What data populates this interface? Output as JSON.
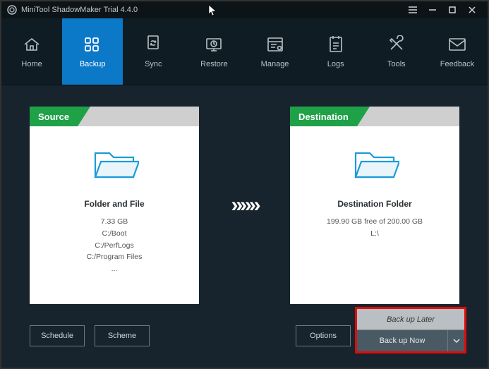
{
  "app": {
    "title": "MiniTool ShadowMaker Trial 4.4.0"
  },
  "toolbar": {
    "items": [
      {
        "label": "Home"
      },
      {
        "label": "Backup"
      },
      {
        "label": "Sync"
      },
      {
        "label": "Restore"
      },
      {
        "label": "Manage"
      },
      {
        "label": "Logs"
      },
      {
        "label": "Tools"
      },
      {
        "label": "Feedback"
      }
    ],
    "active_index": 1
  },
  "source": {
    "tag": "Source",
    "title": "Folder and File",
    "size": "7.33 GB",
    "lines": [
      "C:/Boot",
      "C:/PerfLogs",
      "C:/Program Files",
      "..."
    ]
  },
  "destination": {
    "tag": "Destination",
    "title": "Destination Folder",
    "free": "199.90 GB free of 200.00 GB",
    "path": "L:\\"
  },
  "arrows": "»»»",
  "footer": {
    "schedule": "Schedule",
    "scheme": "Scheme",
    "options": "Options"
  },
  "menu": {
    "later": "Back up Later",
    "now": "Back up Now"
  }
}
